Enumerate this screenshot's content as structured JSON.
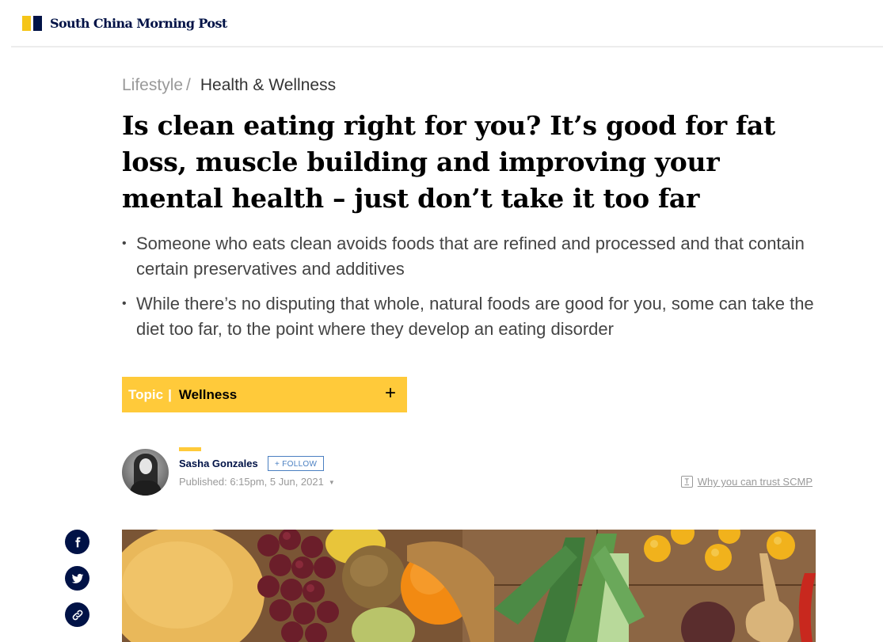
{
  "header": {
    "logo_text": "South China Morning Post",
    "colors": {
      "brand_yellow": "#f5c518",
      "brand_navy": "#001246"
    }
  },
  "breadcrumb": {
    "root": "Lifestyle",
    "separator": "/",
    "current": "Health & Wellness"
  },
  "article": {
    "headline": "Is clean eating right for you? It’s good for fat loss, muscle building and improving your mental health – just don’t take it too far",
    "summary": [
      "Someone who eats clean avoids foods that are refined and processed and that contain certain preservatives and additives",
      "While there’s no disputing that whole, natural foods are good for you, some can take the diet too far, to the point where they develop an eating disorder"
    ]
  },
  "topic": {
    "label": "Topic",
    "divider": "|",
    "name": "Wellness",
    "action": "+",
    "color": "#ffca3a"
  },
  "author": {
    "name": "Sasha Gonzales",
    "follow_label": "+ FOLLOW",
    "published": "Published: 6:15pm, 5 Jun, 2021",
    "trust_link": "Why you can trust SCMP"
  },
  "share": {
    "buttons": [
      "facebook-icon",
      "twitter-icon",
      "link-icon"
    ]
  },
  "hero_image": {
    "subject": "fruits and vegetables on wooden table"
  }
}
